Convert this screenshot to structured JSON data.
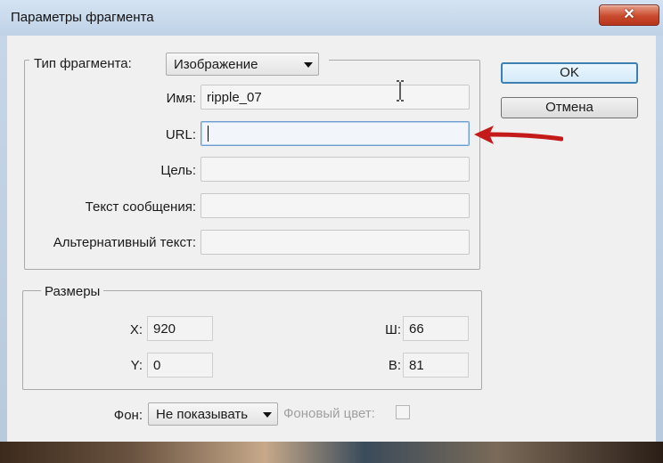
{
  "window": {
    "title": "Параметры фрагмента",
    "close_symbol": "✕"
  },
  "fragment_group": {
    "type_label": "Тип фрагмента:",
    "type_value": "Изображение",
    "name_label": "Имя:",
    "name_value": "ripple_07",
    "url_label": "URL:",
    "url_value": "",
    "target_label": "Цель:",
    "target_value": "",
    "message_label": "Текст сообщения:",
    "message_value": "",
    "alt_label": "Альтернативный текст:",
    "alt_value": ""
  },
  "sizes_group": {
    "legend": "Размеры",
    "x_label": "X:",
    "x_value": "920",
    "y_label": "Y:",
    "y_value": "0",
    "w_label": "Ш:",
    "w_value": "66",
    "h_label": "В:",
    "h_value": "81"
  },
  "background": {
    "label": "Фон:",
    "value": "Не показывать",
    "color_label": "Фоновый цвет:"
  },
  "buttons": {
    "ok": "OK",
    "cancel": "Отмена"
  },
  "annotation": {
    "arrow_color": "#c41a1a",
    "arrow_icon": "red-arrow-icon"
  },
  "icons": {
    "cursor": "i-beam-cursor-icon"
  }
}
